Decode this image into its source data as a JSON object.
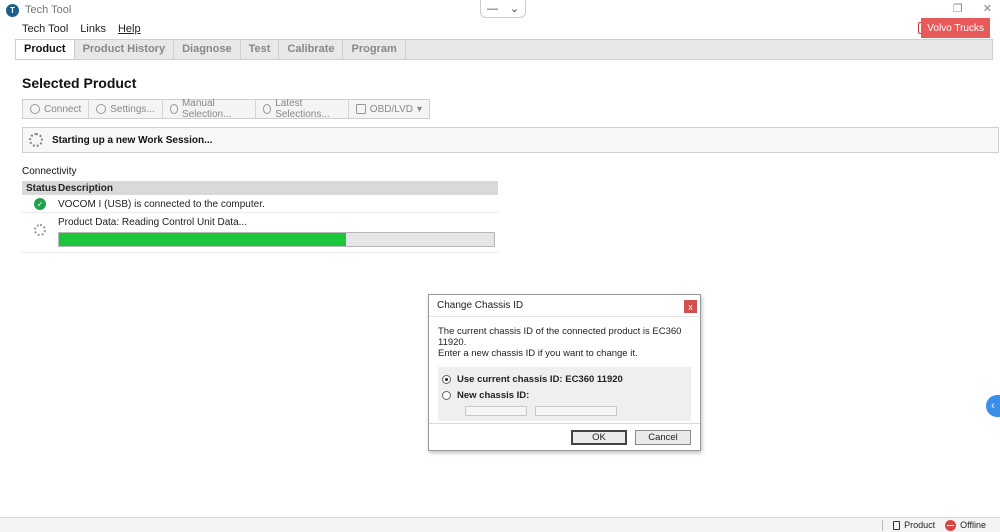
{
  "window": {
    "title": "Tech Tool",
    "app_icon_letter": "T"
  },
  "menu": {
    "items": [
      "Tech Tool",
      "Links",
      "Help"
    ]
  },
  "header": {
    "brand_button": "Volvo Trucks"
  },
  "tabs": [
    "Product",
    "Product History",
    "Diagnose",
    "Test",
    "Calibrate",
    "Program"
  ],
  "page": {
    "title": "Selected Product"
  },
  "toolbar": {
    "connect": "Connect",
    "settings": "Settings...",
    "manual_selection": "Manual Selection...",
    "latest_selections": "Latest Selections...",
    "obd_lvd": "OBD/LVD"
  },
  "work_session": {
    "status": "Starting up a new Work Session..."
  },
  "connectivity": {
    "title": "Connectivity",
    "columns": {
      "status": "Status",
      "description": "Description"
    },
    "rows": [
      {
        "description": "VOCOM I (USB) is connected to the computer."
      },
      {
        "description": "Product Data: Reading Control Unit Data...",
        "progress": 0.66
      }
    ]
  },
  "dialog": {
    "title": "Change Chassis ID",
    "close": "x",
    "message_1": "The current chassis ID of the connected product is EC360 11920.",
    "message_2": "Enter a new chassis ID if you want to change it.",
    "option_current": "Use current chassis ID: EC360 11920",
    "option_new": "New chassis ID:",
    "ok": "OK",
    "cancel": "Cancel"
  },
  "statusbar": {
    "product": "Product",
    "offline": "Offline"
  },
  "colors": {
    "progress": "#1cc63a",
    "brand_button": "#e85a5a",
    "side_handle": "#3c8fe8"
  }
}
